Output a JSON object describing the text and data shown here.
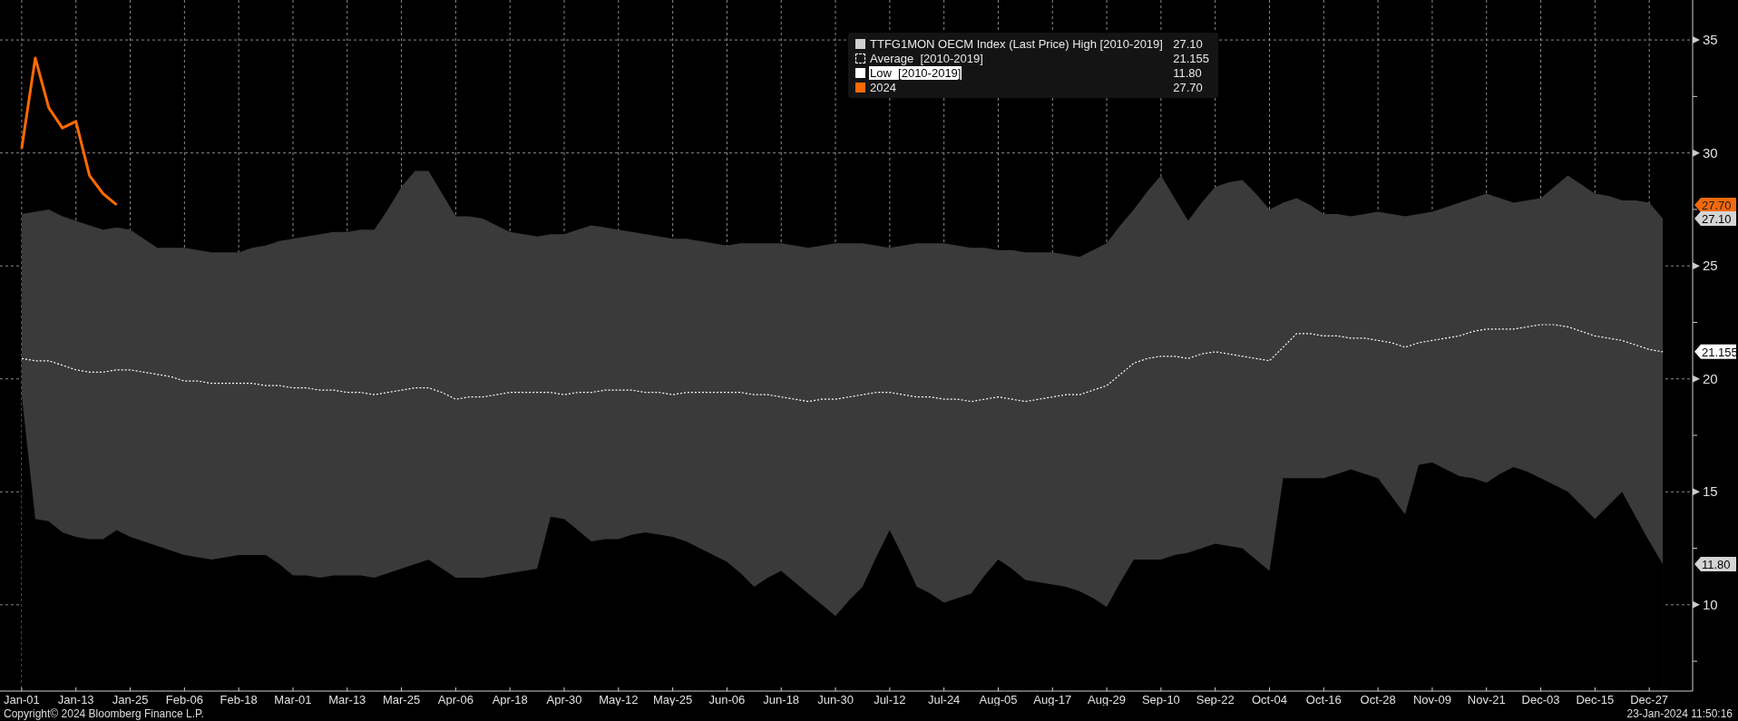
{
  "chart": {
    "chart_data": {
      "type": "line",
      "title": "TTFG1MON OECM Index (Last Price)",
      "categories": [
        "Jan-01",
        null,
        null,
        null,
        "Jan-13",
        null,
        null,
        null,
        "Jan-25",
        null,
        null,
        null,
        "Feb-06",
        null,
        null,
        null,
        "Feb-18",
        null,
        null,
        null,
        "Mar-01",
        null,
        null,
        null,
        "Mar-13",
        null,
        null,
        null,
        "Mar-25",
        null,
        null,
        null,
        "Apr-06",
        null,
        null,
        null,
        "Apr-18",
        null,
        null,
        null,
        "Apr-30",
        null,
        null,
        null,
        "May-12",
        null,
        null,
        null,
        "May-25",
        null,
        null,
        null,
        "Jun-06",
        null,
        null,
        null,
        "Jun-18",
        null,
        null,
        null,
        "Jun-30",
        null,
        null,
        null,
        "Jul-12",
        null,
        null,
        null,
        "Jul-24",
        null,
        null,
        null,
        "Aug-05",
        null,
        null,
        null,
        "Aug-17",
        null,
        null,
        null,
        "Aug-29",
        null,
        null,
        null,
        "Sep-10",
        null,
        null,
        null,
        "Sep-22",
        null,
        null,
        null,
        "Oct-04",
        null,
        null,
        null,
        "Oct-16",
        null,
        null,
        null,
        "Oct-28",
        null,
        null,
        null,
        "Nov-09",
        null,
        null,
        null,
        "Nov-21",
        null,
        null,
        null,
        "Dec-03",
        null,
        null,
        null,
        "Dec-15",
        null,
        null,
        null,
        "Dec-27",
        null
      ],
      "ylim": [
        6.18,
        36.77
      ],
      "grid": true,
      "yticks": [
        10,
        15,
        20,
        25,
        30,
        35
      ],
      "series": [
        {
          "name": "High [2010-2019]",
          "type": "area",
          "color": "#3a3a3a",
          "values": [
            27.3,
            27.4,
            27.5,
            27.2,
            27.0,
            26.8,
            26.6,
            26.7,
            26.6,
            26.2,
            25.8,
            25.8,
            25.8,
            25.7,
            25.6,
            25.6,
            25.6,
            25.8,
            25.9,
            26.1,
            26.2,
            26.3,
            26.4,
            26.5,
            26.5,
            26.6,
            26.6,
            27.5,
            28.5,
            29.2,
            29.2,
            28.2,
            27.2,
            27.2,
            27.1,
            26.8,
            26.5,
            26.4,
            26.3,
            26.4,
            26.4,
            26.6,
            26.8,
            26.7,
            26.6,
            26.5,
            26.4,
            26.3,
            26.2,
            26.2,
            26.1,
            26.0,
            25.9,
            26.0,
            26.0,
            26.0,
            26.0,
            25.9,
            25.8,
            25.9,
            26.0,
            26.0,
            26.0,
            25.9,
            25.8,
            25.9,
            26.0,
            26.0,
            26.0,
            25.9,
            25.8,
            25.8,
            25.7,
            25.7,
            25.6,
            25.6,
            25.6,
            25.5,
            25.4,
            25.7,
            26.0,
            26.8,
            27.5,
            28.3,
            29.0,
            28.0,
            27.0,
            27.8,
            28.5,
            28.7,
            28.8,
            28.2,
            27.5,
            27.8,
            28.0,
            27.7,
            27.3,
            27.3,
            27.2,
            27.3,
            27.4,
            27.3,
            27.2,
            27.3,
            27.4,
            27.6,
            27.8,
            28.0,
            28.2,
            28.0,
            27.8,
            27.9,
            28.0,
            28.5,
            29.0,
            28.6,
            28.2,
            28.1,
            27.9,
            27.9,
            27.8,
            27.1
          ]
        },
        {
          "name": "Average  [2010-2019]",
          "type": "line",
          "line_style": "dashed",
          "color": "#ffffff",
          "values": [
            20.9,
            20.8,
            20.8,
            20.6,
            20.4,
            20.3,
            20.3,
            20.4,
            20.4,
            20.3,
            20.2,
            20.1,
            19.9,
            19.9,
            19.8,
            19.8,
            19.8,
            19.8,
            19.7,
            19.7,
            19.6,
            19.6,
            19.5,
            19.5,
            19.4,
            19.4,
            19.3,
            19.4,
            19.5,
            19.6,
            19.6,
            19.4,
            19.1,
            19.2,
            19.2,
            19.3,
            19.4,
            19.4,
            19.4,
            19.4,
            19.3,
            19.4,
            19.4,
            19.5,
            19.5,
            19.5,
            19.4,
            19.4,
            19.3,
            19.4,
            19.4,
            19.4,
            19.4,
            19.4,
            19.3,
            19.3,
            19.2,
            19.1,
            19.0,
            19.1,
            19.1,
            19.2,
            19.3,
            19.4,
            19.4,
            19.3,
            19.2,
            19.2,
            19.1,
            19.1,
            19.0,
            19.1,
            19.2,
            19.1,
            19.0,
            19.1,
            19.2,
            19.3,
            19.3,
            19.5,
            19.7,
            20.2,
            20.7,
            20.9,
            21.0,
            21.0,
            20.9,
            21.1,
            21.2,
            21.1,
            21.0,
            20.9,
            20.8,
            21.4,
            22.0,
            22.0,
            21.9,
            21.9,
            21.8,
            21.8,
            21.7,
            21.6,
            21.4,
            21.6,
            21.7,
            21.8,
            21.9,
            22.1,
            22.2,
            22.2,
            22.2,
            22.3,
            22.4,
            22.4,
            22.3,
            22.1,
            21.9,
            21.8,
            21.7,
            21.5,
            21.3,
            21.2
          ]
        },
        {
          "name": "Low  [2010-2019]",
          "type": "area",
          "color": "#000000",
          "values": [
            19.3,
            13.8,
            13.7,
            13.2,
            13.0,
            12.9,
            12.9,
            13.3,
            13.0,
            12.8,
            12.6,
            12.4,
            12.2,
            12.1,
            12.0,
            12.1,
            12.2,
            12.2,
            12.2,
            11.8,
            11.3,
            11.3,
            11.2,
            11.3,
            11.3,
            11.3,
            11.2,
            11.4,
            11.6,
            11.8,
            12.0,
            11.6,
            11.2,
            11.2,
            11.2,
            11.3,
            11.4,
            11.5,
            11.6,
            13.9,
            13.8,
            13.3,
            12.8,
            12.9,
            12.9,
            13.1,
            13.2,
            13.1,
            13.0,
            12.8,
            12.5,
            12.2,
            11.9,
            11.4,
            10.8,
            11.2,
            11.5,
            11.0,
            10.5,
            10.0,
            9.5,
            10.2,
            10.8,
            12.1,
            13.3,
            12.1,
            10.8,
            10.5,
            10.1,
            10.3,
            10.5,
            11.3,
            12.0,
            11.6,
            11.1,
            11.0,
            10.9,
            10.8,
            10.6,
            10.3,
            9.9,
            11.0,
            12.0,
            12.0,
            12.0,
            12.2,
            12.3,
            12.5,
            12.7,
            12.6,
            12.5,
            12.0,
            11.5,
            15.6,
            15.6,
            15.6,
            15.6,
            15.8,
            16.0,
            15.8,
            15.6,
            14.8,
            14.0,
            16.2,
            16.3,
            16.0,
            15.7,
            15.6,
            15.4,
            15.8,
            16.1,
            15.9,
            15.6,
            15.3,
            15.0,
            14.4,
            13.8,
            14.4,
            15.0,
            13.9,
            12.8,
            11.8
          ]
        },
        {
          "name": "2024",
          "type": "line",
          "color": "#ff6a00",
          "values": [
            30.2,
            34.2,
            32.0,
            31.1,
            31.4,
            29.0,
            28.2,
            27.7,
            null,
            null,
            null,
            null,
            null,
            null,
            null,
            null,
            null,
            null,
            null,
            null,
            null,
            null,
            null,
            null,
            null,
            null,
            null,
            null,
            null,
            null,
            null,
            null,
            null,
            null,
            null,
            null,
            null,
            null,
            null,
            null,
            null,
            null,
            null,
            null,
            null,
            null,
            null,
            null,
            null,
            null,
            null,
            null,
            null,
            null,
            null,
            null,
            null,
            null,
            null,
            null,
            null,
            null,
            null,
            null,
            null,
            null,
            null,
            null,
            null,
            null,
            null,
            null,
            null,
            null,
            null,
            null,
            null,
            null,
            null,
            null,
            null,
            null,
            null,
            null,
            null,
            null,
            null,
            null,
            null,
            null,
            null,
            null,
            null,
            null,
            null,
            null,
            null,
            null,
            null,
            null,
            null,
            null,
            null,
            null,
            null,
            null,
            null,
            null,
            null,
            null,
            null,
            null,
            null,
            null,
            null,
            null,
            null,
            null,
            null,
            null,
            null,
            null
          ]
        }
      ]
    },
    "legend": [
      {
        "kind": "high",
        "value": "27.10",
        "highlighted": false
      },
      {
        "kind": "average",
        "value": "21.155",
        "highlighted": false
      },
      {
        "kind": "low",
        "value": "11.80",
        "highlighted": true
      },
      {
        "kind": "current",
        "value": "27.70",
        "highlighted": false
      }
    ],
    "price_tags": [
      {
        "kind": "current",
        "text": "27.70"
      },
      {
        "kind": "high",
        "text": "27.10"
      },
      {
        "kind": "average",
        "text": "21.155"
      },
      {
        "kind": "low",
        "text": "11.80"
      }
    ]
  },
  "footer": {
    "copyright": "Copyright© 2024 Bloomberg Finance L.P.",
    "timestamp": "23-Jan-2024 11:50:16"
  }
}
